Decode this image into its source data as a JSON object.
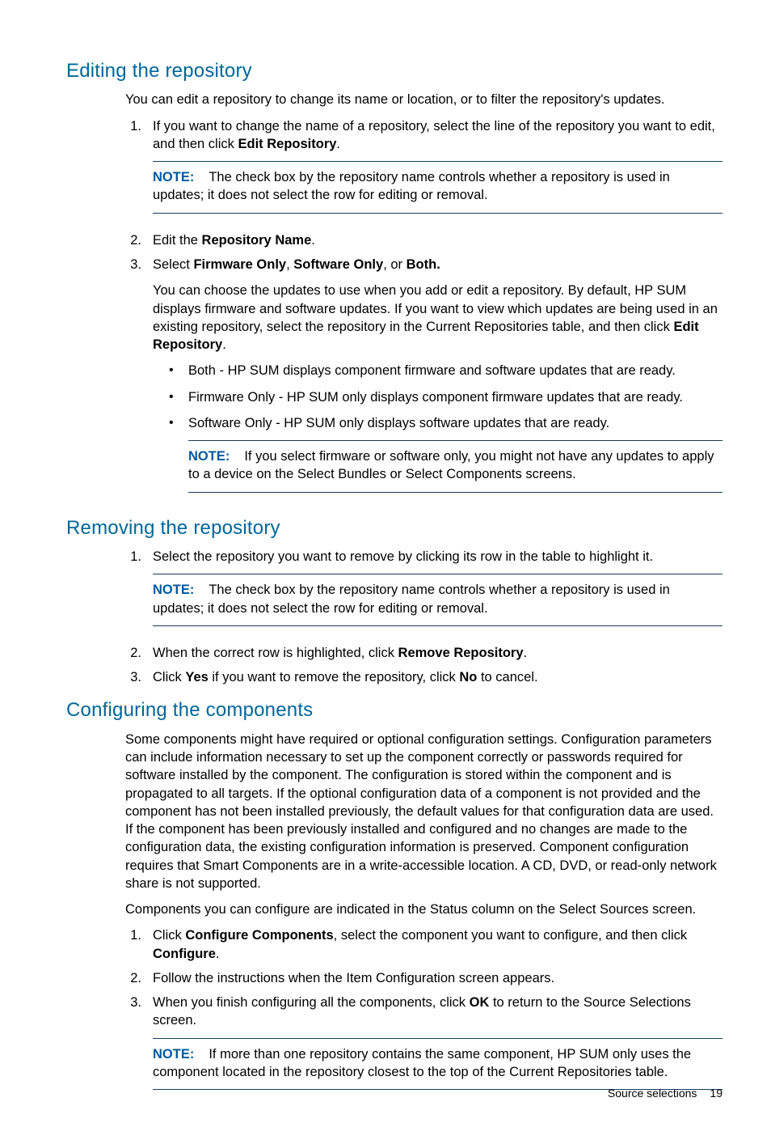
{
  "sections": {
    "editing": {
      "heading": "Editing the repository",
      "intro": "You can edit a repository to change its name or location, or to filter the repository's updates.",
      "step1_pre": "If you want to change the name of a repository, select the line of the repository you want to edit, and then click ",
      "step1_bold": "Edit Repository",
      "note1_label": "NOTE:",
      "note1_text": "The check box by the repository name controls whether a repository is used in updates; it does not select the row for editing or removal.",
      "step2_pre": "Edit the ",
      "step2_bold": "Repository Name",
      "step3_pre": "Select ",
      "step3_b1": "Firmware Only",
      "step3_mid1": ", ",
      "step3_b2": "Software Only",
      "step3_mid2": ", or ",
      "step3_b3": "Both.",
      "step3_para_pre": "You can choose the updates to use when you add or edit a repository. By default, HP SUM displays firmware and software updates. If you want to view which updates are being used in an existing repository, select the repository in the Current Repositories table, and then click ",
      "step3_para_bold": "Edit Repository",
      "bullets": {
        "b1": "Both - HP SUM displays component firmware and software updates that are ready.",
        "b2": "Firmware Only - HP SUM only displays component firmware updates that are ready.",
        "b3": "Software Only - HP SUM only displays software updates that are ready."
      },
      "note2_label": "NOTE:",
      "note2_text": "If you select firmware or software only, you might not have any updates to apply to a device on the Select Bundles or Select Components screens."
    },
    "removing": {
      "heading": "Removing the repository",
      "step1": "Select the repository you want to remove by clicking its row in the table to highlight it.",
      "note_label": "NOTE:",
      "note_text": "The check box by the repository name controls whether a repository is used in updates; it does not select the row for editing or removal.",
      "step2_pre": "When the correct row is highlighted, click ",
      "step2_bold": "Remove Repository",
      "step3_pre": "Click ",
      "step3_b1": "Yes",
      "step3_mid": " if you want to remove the repository, click ",
      "step3_b2": "No",
      "step3_post": " to cancel."
    },
    "configuring": {
      "heading": "Configuring the components",
      "para1": "Some components might have required or optional configuration settings. Configuration parameters can include information necessary to set up the component correctly or passwords required for software installed by the component. The configuration is stored within the component and is propagated to all targets. If the optional configuration data of a component is not provided and the component has not been installed previously, the default values for that configuration data are used. If the component has been previously installed and configured and no changes are made to the configuration data, the existing configuration information is preserved. Component configuration requires that Smart Components are in a write-accessible location. A CD, DVD, or read-only network share is not supported.",
      "para2": "Components you can configure are indicated in the Status column on the Select Sources screen.",
      "step1_pre": "Click ",
      "step1_b1": "Configure Components",
      "step1_mid": ", select the component you want to configure, and then click ",
      "step1_b2": "Configure",
      "step2": "Follow the instructions when the Item Configuration screen appears.",
      "step3_pre": "When you finish configuring all the components, click ",
      "step3_b1": "OK",
      "step3_post": " to return to the Source Selections screen.",
      "note_label": "NOTE:",
      "note_text": "If more than one repository contains the same component, HP SUM only uses the component located in the repository closest to the top of the Current Repositories table."
    }
  },
  "footer": {
    "section": "Source selections",
    "page": "19"
  }
}
